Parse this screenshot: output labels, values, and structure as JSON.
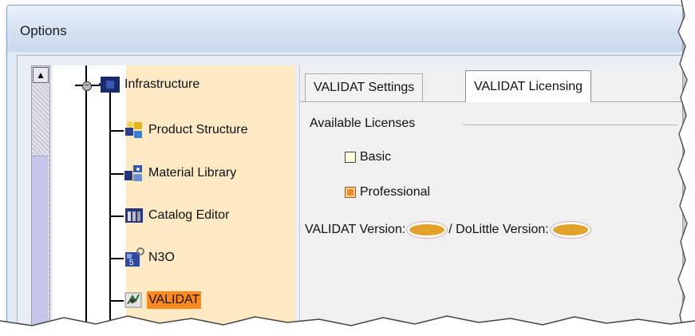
{
  "window": {
    "title": "Options"
  },
  "tree": {
    "items": [
      {
        "label": "Infrastructure",
        "icon": "infrastructure-icon",
        "selected": false
      },
      {
        "label": "Product Structure",
        "icon": "product-structure-icon",
        "selected": false
      },
      {
        "label": "Material Library",
        "icon": "material-library-icon",
        "selected": false
      },
      {
        "label": "Catalog Editor",
        "icon": "catalog-editor-icon",
        "selected": false
      },
      {
        "label": "N3O",
        "icon": "n3o-icon",
        "selected": false
      },
      {
        "label": "VALIDAT",
        "icon": "validat-icon",
        "selected": true
      }
    ],
    "expander_symbol": "−",
    "scroll_up_symbol": "▲"
  },
  "tabs": [
    {
      "label": "VALIDAT Settings",
      "active": false
    },
    {
      "label": "VALIDAT Licensing",
      "active": true
    }
  ],
  "licensing": {
    "group_title": "Available Licenses",
    "options": [
      {
        "label": "Basic",
        "checked": false
      },
      {
        "label": "Professional",
        "checked": true
      }
    ],
    "validat_version_label": "VALIDAT Version: ",
    "dolittle_version_label": "/ DoLittle Version: "
  },
  "colors": {
    "tree_highlight": "#fde9c3",
    "selected_label": "#ff8a1f",
    "redaction_oval": "#e2a227"
  }
}
